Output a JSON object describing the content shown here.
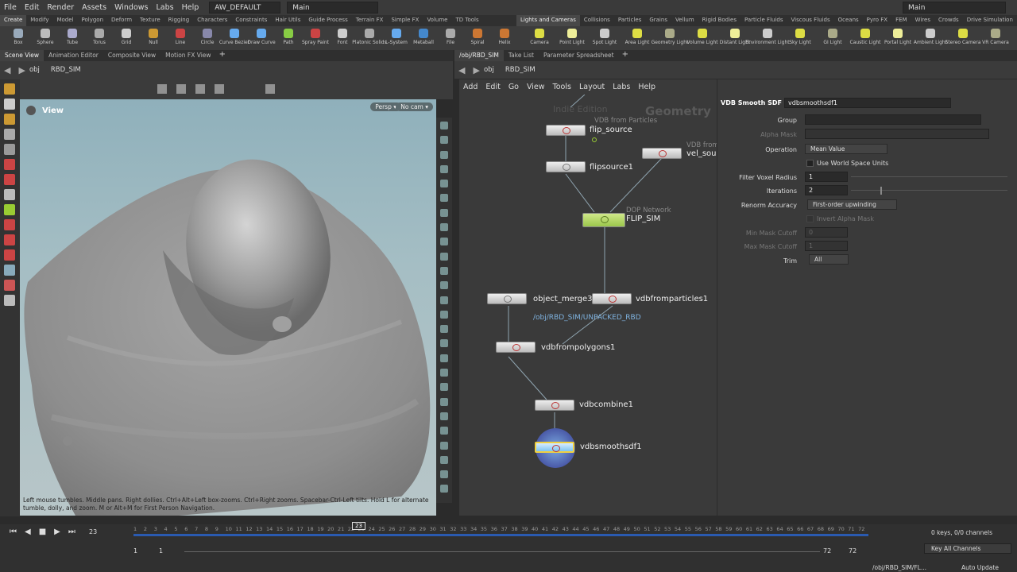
{
  "menubar": {
    "items": [
      "File",
      "Edit",
      "Render",
      "Assets",
      "Windows",
      "Labs",
      "Help"
    ],
    "desktop": "AW_DEFAULT",
    "context": "Main",
    "right_context": "Main"
  },
  "shelf_tabs_left": [
    "Create",
    "Modify",
    "Model",
    "Polygon",
    "Deform",
    "Texture",
    "Rigging",
    "Characters",
    "Constraints",
    "Hair Utils",
    "Guide Process",
    "Terrain FX",
    "Simple FX",
    "Volume",
    "TD Tools"
  ],
  "shelf_tabs_right": [
    "Lights and Cameras",
    "Collisions",
    "Particles",
    "Grains",
    "Vellum",
    "Rigid Bodies",
    "Particle Fluids",
    "Viscous Fluids",
    "Oceans",
    "Pyro FX",
    "FEM",
    "Wires",
    "Crowds",
    "Drive Simulation"
  ],
  "tools_left": [
    "Box",
    "Sphere",
    "Tube",
    "Torus",
    "Grid",
    "Null",
    "Line",
    "Circle",
    "Curve Bezier",
    "Draw Curve",
    "Path",
    "Spray Paint",
    "Font",
    "Platonic Solids",
    "L-System",
    "Metaball",
    "File",
    "Spiral",
    "Helix"
  ],
  "tools_right": [
    "Camera",
    "Point Light",
    "Spot Light",
    "Area Light",
    "Geometry Light",
    "Volume Light",
    "Distant Light",
    "Environment Light",
    "Sky Light",
    "GI Light",
    "Caustic Light",
    "Portal Light",
    "Ambient Light",
    "Stereo Camera",
    "VR Camera"
  ],
  "left_tabs": [
    "Scene View",
    "Animation Editor",
    "Composite View",
    "Motion FX View"
  ],
  "right_tabs": [
    "/obj/RBD_SIM",
    "Take List",
    "Parameter Spreadsheet"
  ],
  "path_left": {
    "obj": "obj",
    "node": "RBD_SIM"
  },
  "path_right": {
    "obj": "obj",
    "node": "RBD_SIM"
  },
  "viewport": {
    "title": "View",
    "persp": "Persp",
    "cam": "No cam",
    "help": "Left mouse tumbles. Middle pans. Right dollies. Ctrl+Alt+Left box-zooms. Ctrl+Right zooms. Spacebar-Ctrl-Left tilts. Hold L for alternate tumble, dolly, and zoom. M or Alt+M for First Person Navigation."
  },
  "network": {
    "menu": [
      "Add",
      "Edit",
      "Go",
      "View",
      "Tools",
      "Layout",
      "Labs",
      "Help"
    ],
    "watermark": "Indie Edition",
    "context_label": "Geometry",
    "nodes": {
      "flip_source": {
        "name": "flip_source",
        "sub": "VDB from Particles"
      },
      "flipsource1": {
        "name": "flipsource1"
      },
      "vel_source": {
        "name": "vel_sour",
        "sub": "VDB from"
      },
      "flip_sim": {
        "name": "FLIP_SIM",
        "sub": "DOP Network"
      },
      "object_merge3": {
        "name": "object_merge3",
        "path": "/obj/RBD_SIM/UNPACKED_RBD"
      },
      "vdbfromparticles1": {
        "name": "vdbfromparticles1"
      },
      "vdbfrompolygons1": {
        "name": "vdbfrompolygons1"
      },
      "vdbcombine1": {
        "name": "vdbcombine1"
      },
      "vdbsmoothsdf1": {
        "name": "vdbsmoothsdf1"
      }
    }
  },
  "params": {
    "node_type": "VDB Smooth SDF",
    "node_name": "vdbsmoothsdf1",
    "group_label": "Group",
    "alpha_mask_label": "Alpha Mask",
    "operation_label": "Operation",
    "operation_value": "Mean Value",
    "world_space_label": "Use World Space Units",
    "filter_voxel_label": "Filter Voxel Radius",
    "filter_voxel_value": "1",
    "iterations_label": "Iterations",
    "iterations_value": "2",
    "renorm_label": "Renorm Accuracy",
    "renorm_value": "First-order upwinding",
    "invert_label": "Invert Alpha Mask",
    "min_mask_label": "Min Mask Cutoff",
    "min_mask_value": "0",
    "max_mask_label": "Max Mask Cutoff",
    "max_mask_value": "1",
    "trim_label": "Trim",
    "trim_value": "All"
  },
  "timeline": {
    "frame": "23",
    "current_marker": "23",
    "start": "1",
    "start2": "1",
    "end": "72",
    "end2": "72",
    "ticks": [
      "1",
      "2",
      "3",
      "4",
      "5",
      "6",
      "7",
      "8",
      "9",
      "10",
      "11",
      "12",
      "13",
      "14",
      "15",
      "16",
      "17",
      "18",
      "19",
      "20",
      "21",
      "22",
      "23",
      "24",
      "25",
      "26",
      "27",
      "28",
      "29",
      "30",
      "31",
      "32",
      "33",
      "34",
      "35",
      "36",
      "37",
      "38",
      "39",
      "40",
      "41",
      "42",
      "43",
      "44",
      "45",
      "46",
      "47",
      "48",
      "49",
      "50",
      "51",
      "52",
      "53",
      "54",
      "55",
      "56",
      "57",
      "58",
      "59",
      "60",
      "61",
      "62",
      "63",
      "64",
      "65",
      "66",
      "67",
      "68",
      "69",
      "70",
      "71",
      "72"
    ],
    "keys": "0 keys, 0/0 channels",
    "key_all": "Key All Channels",
    "status_path": "/obj/RBD_SIM/FL...",
    "update_mode": "Auto Update"
  }
}
